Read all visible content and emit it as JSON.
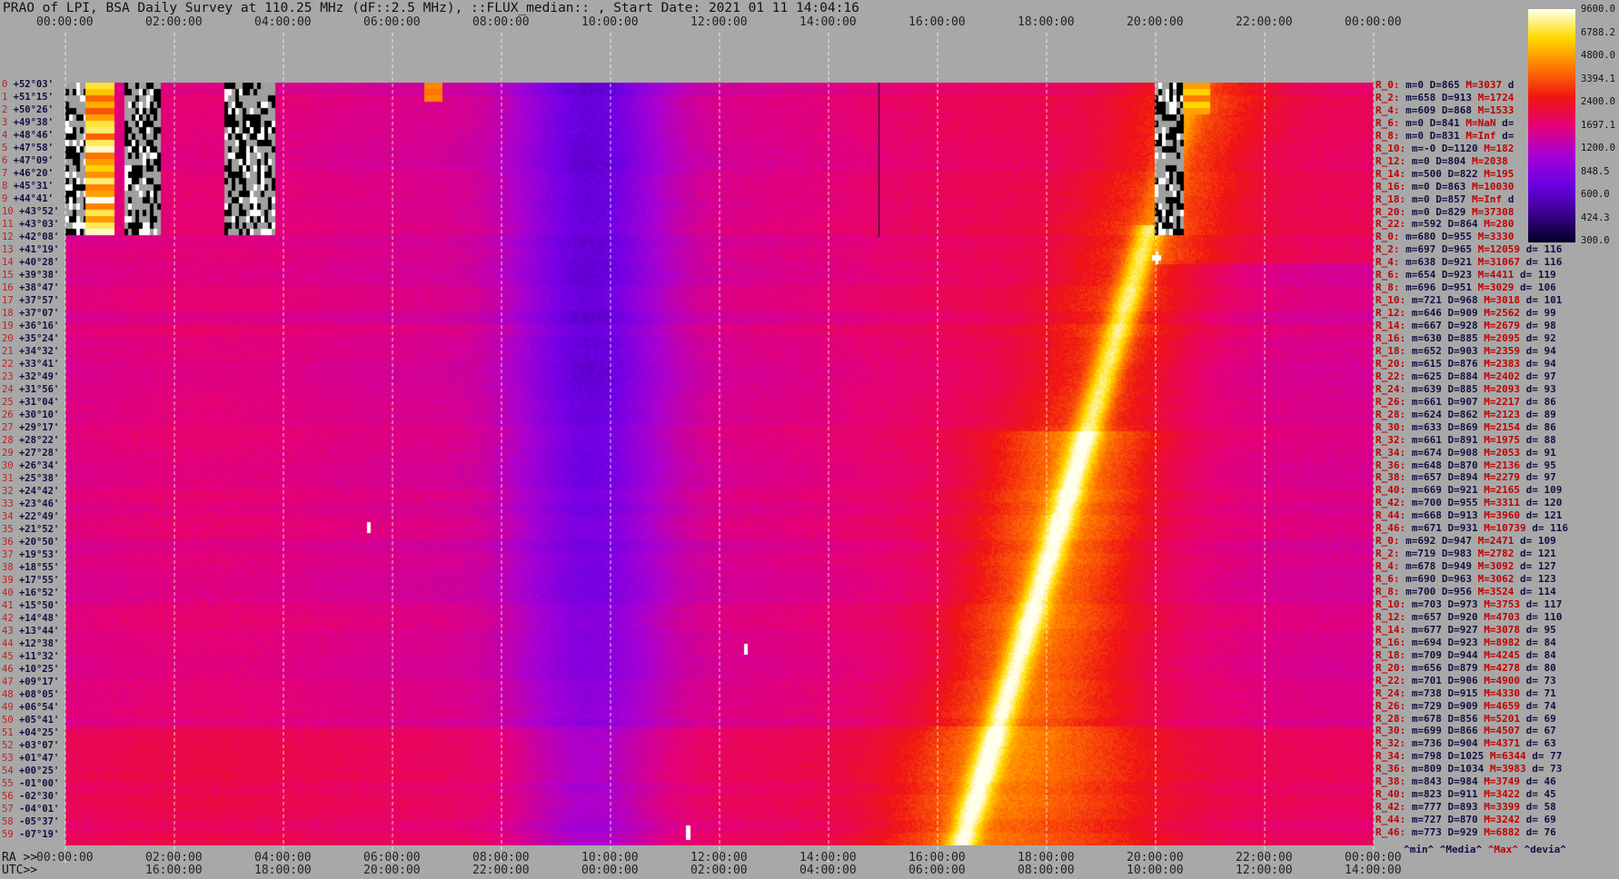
{
  "title": "PRAO of LPI, BSA Daily Survey at 110.25 MHz (dF::2.5 MHz), ::FLUX_median:: , Start Date: 2021 01 11 14:04:16",
  "footer": {
    "ra_prefix": "RA >>",
    "utc_prefix": "UTC>>",
    "legend": [
      "^min^",
      "^Media^",
      "^Max^",
      "^devia^"
    ]
  },
  "colors": {
    "background": "#a8a8a8",
    "label_dark": "#101040",
    "label_red": "#c00000"
  },
  "chart_data": {
    "type": "heatmap",
    "x_top_ticks": [
      "00:00:00",
      "02:00:00",
      "04:00:00",
      "06:00:00",
      "08:00:00",
      "10:00:00",
      "12:00:00",
      "14:00:00",
      "16:00:00",
      "18:00:00",
      "20:00:00",
      "22:00:00",
      "00:00:00"
    ],
    "x_bottom_ra_ticks": [
      "00:00:00",
      "02:00:00",
      "04:00:00",
      "06:00:00",
      "08:00:00",
      "10:00:00",
      "12:00:00",
      "14:00:00",
      "16:00:00",
      "18:00:00",
      "20:00:00",
      "22:00:00",
      "00:00:00"
    ],
    "x_bottom_utc_ticks": [
      "16:00:00",
      "18:00:00",
      "20:00:00",
      "22:00:00",
      "00:00:00",
      "02:00:00",
      "04:00:00",
      "06:00:00",
      "08:00:00",
      "10:00:00",
      "12:00:00",
      "14:00:00"
    ],
    "declinations": [
      "+52°03'",
      "+51°15'",
      "+50°26'",
      "+49°38'",
      "+48°46'",
      "+47°58'",
      "+47°09'",
      "+46°20'",
      "+45°31'",
      "+44°41'",
      "+43°52'",
      "+43°03'",
      "+42°08'",
      "+41°19'",
      "+40°28'",
      "+39°38'",
      "+38°47'",
      "+37°57'",
      "+37°07'",
      "+36°16'",
      "+35°24'",
      "+34°32'",
      "+33°41'",
      "+32°49'",
      "+31°56'",
      "+31°04'",
      "+30°10'",
      "+29°17'",
      "+28°22'",
      "+27°28'",
      "+26°34'",
      "+25°38'",
      "+24°42'",
      "+23°46'",
      "+22°49'",
      "+21°52'",
      "+20°50'",
      "+19°53'",
      "+18°55'",
      "+17°55'",
      "+16°52'",
      "+15°50'",
      "+14°48'",
      "+13°44'",
      "+12°38'",
      "+11°32'",
      "+10°25'",
      "+09°17'",
      "+08°05'",
      "+06°54'",
      "+05°41'",
      "+04°25'",
      "+03°07'",
      "+01°47'",
      "+00°25'",
      "-01°00'",
      "-02°30'",
      "-04°01'",
      "-05°37'",
      "-07°19'"
    ],
    "dec_index": [
      "0",
      "1",
      "2",
      "3",
      "4",
      "5",
      "6",
      "7",
      "8",
      "9",
      "10",
      "11",
      "12",
      "13",
      "14",
      "15",
      "16",
      "17",
      "18",
      "19",
      "20",
      "21",
      "22",
      "23",
      "24",
      "25",
      "26",
      "27",
      "28",
      "29",
      "30",
      "31",
      "32",
      "33",
      "34",
      "35",
      "36",
      "37",
      "38",
      "39",
      "40",
      "41",
      "42",
      "43",
      "44",
      "45",
      "46",
      "47",
      "48",
      "49",
      "50",
      "51",
      "52",
      "53",
      "54",
      "55",
      "56",
      "57",
      "58",
      "59"
    ],
    "colorbar": {
      "ticks": [
        "9600.0",
        "6788.2",
        "4800.0",
        "3394.1",
        "2400.0",
        "1697.1",
        "1200.0",
        "848.5",
        "600.0",
        "424.3",
        "300.0"
      ],
      "colormap": "gnuplot-hot"
    },
    "stats": [
      {
        "r": "R_0:",
        "min": "m=0",
        "med": "D=865",
        "max": "M=3037",
        "dev": "d"
      },
      {
        "r": "R_2:",
        "min": "m=658",
        "med": "D=913",
        "max": "M=1724",
        "dev": ""
      },
      {
        "r": "R_4:",
        "min": "m=609",
        "med": "D=868",
        "max": "M=1533",
        "dev": ""
      },
      {
        "r": "R_6:",
        "min": "m=0",
        "med": "D=841",
        "max": "M=NaN",
        "dev": "d="
      },
      {
        "r": "R_8:",
        "min": "m=0",
        "med": "D=831",
        "max": "M=Inf",
        "dev": "d="
      },
      {
        "r": "R_10:",
        "min": "m=-0",
        "med": "D=1120",
        "max": "M=182",
        "dev": ""
      },
      {
        "r": "R_12:",
        "min": "m=0",
        "med": "D=804",
        "max": "M=2038",
        "dev": ""
      },
      {
        "r": "R_14:",
        "min": "m=500",
        "med": "D=822",
        "max": "M=195",
        "dev": ""
      },
      {
        "r": "R_16:",
        "min": "m=0",
        "med": "D=863",
        "max": "M=10030",
        "dev": ""
      },
      {
        "r": "R_18:",
        "min": "m=0",
        "med": "D=857",
        "max": "M=Inf",
        "dev": "d"
      },
      {
        "r": "R_20:",
        "min": "m=0",
        "med": "D=829",
        "max": "M=37308",
        "dev": ""
      },
      {
        "r": "R_22:",
        "min": "m=592",
        "med": "D=864",
        "max": "M=280",
        "dev": ""
      },
      {
        "r": "R_0:",
        "min": "m=680",
        "med": "D=955",
        "max": "M=3330",
        "dev": ""
      },
      {
        "r": "R_2:",
        "min": "m=697",
        "med": "D=965",
        "max": "M=12059",
        "dev": "d= 116"
      },
      {
        "r": "R_4:",
        "min": "m=638",
        "med": "D=921",
        "max": "M=31067",
        "dev": "d= 116"
      },
      {
        "r": "R_6:",
        "min": "m=654",
        "med": "D=923",
        "max": "M=4411",
        "dev": "d= 119"
      },
      {
        "r": "R_8:",
        "min": "m=696",
        "med": "D=951",
        "max": "M=3029",
        "dev": "d= 106"
      },
      {
        "r": "R_10:",
        "min": "m=721",
        "med": "D=968",
        "max": "M=3018",
        "dev": "d= 101"
      },
      {
        "r": "R_12:",
        "min": "m=646",
        "med": "D=909",
        "max": "M=2562",
        "dev": "d= 99"
      },
      {
        "r": "R_14:",
        "min": "m=667",
        "med": "D=928",
        "max": "M=2679",
        "dev": "d= 98"
      },
      {
        "r": "R_16:",
        "min": "m=630",
        "med": "D=885",
        "max": "M=2095",
        "dev": "d= 92"
      },
      {
        "r": "R_18:",
        "min": "m=652",
        "med": "D=903",
        "max": "M=2359",
        "dev": "d= 94"
      },
      {
        "r": "R_20:",
        "min": "m=615",
        "med": "D=876",
        "max": "M=2383",
        "dev": "d= 94"
      },
      {
        "r": "R_22:",
        "min": "m=625",
        "med": "D=884",
        "max": "M=2402",
        "dev": "d= 97"
      },
      {
        "r": "R_24:",
        "min": "m=639",
        "med": "D=885",
        "max": "M=2093",
        "dev": "d= 93"
      },
      {
        "r": "R_26:",
        "min": "m=661",
        "med": "D=907",
        "max": "M=2217",
        "dev": "d= 86"
      },
      {
        "r": "R_28:",
        "min": "m=624",
        "med": "D=862",
        "max": "M=2123",
        "dev": "d= 89"
      },
      {
        "r": "R_30:",
        "min": "m=633",
        "med": "D=869",
        "max": "M=2154",
        "dev": "d= 86"
      },
      {
        "r": "R_32:",
        "min": "m=661",
        "med": "D=891",
        "max": "M=1975",
        "dev": "d= 88"
      },
      {
        "r": "R_34:",
        "min": "m=674",
        "med": "D=908",
        "max": "M=2053",
        "dev": "d= 91"
      },
      {
        "r": "R_36:",
        "min": "m=648",
        "med": "D=870",
        "max": "M=2136",
        "dev": "d= 95"
      },
      {
        "r": "R_38:",
        "min": "m=657",
        "med": "D=894",
        "max": "M=2279",
        "dev": "d= 97"
      },
      {
        "r": "R_40:",
        "min": "m=669",
        "med": "D=921",
        "max": "M=2165",
        "dev": "d= 109"
      },
      {
        "r": "R_42:",
        "min": "m=700",
        "med": "D=955",
        "max": "M=3311",
        "dev": "d= 120"
      },
      {
        "r": "R_44:",
        "min": "m=668",
        "med": "D=913",
        "max": "M=3960",
        "dev": "d= 121"
      },
      {
        "r": "R_46:",
        "min": "m=671",
        "med": "D=931",
        "max": "M=10739",
        "dev": "d= 116"
      },
      {
        "r": "R_0:",
        "min": "m=692",
        "med": "D=947",
        "max": "M=2471",
        "dev": "d= 109"
      },
      {
        "r": "R_2:",
        "min": "m=719",
        "med": "D=983",
        "max": "M=2782",
        "dev": "d= 121"
      },
      {
        "r": "R_4:",
        "min": "m=678",
        "med": "D=949",
        "max": "M=3092",
        "dev": "d= 127"
      },
      {
        "r": "R_6:",
        "min": "m=690",
        "med": "D=963",
        "max": "M=3062",
        "dev": "d= 123"
      },
      {
        "r": "R_8:",
        "min": "m=700",
        "med": "D=956",
        "max": "M=3524",
        "dev": "d= 114"
      },
      {
        "r": "R_10:",
        "min": "m=703",
        "med": "D=973",
        "max": "M=3753",
        "dev": "d= 117"
      },
      {
        "r": "R_12:",
        "min": "m=657",
        "med": "D=920",
        "max": "M=4703",
        "dev": "d= 110"
      },
      {
        "r": "R_14:",
        "min": "m=677",
        "med": "D=927",
        "max": "M=3078",
        "dev": "d= 95"
      },
      {
        "r": "R_16:",
        "min": "m=694",
        "med": "D=923",
        "max": "M=8982",
        "dev": "d= 84"
      },
      {
        "r": "R_18:",
        "min": "m=709",
        "med": "D=944",
        "max": "M=4245",
        "dev": "d= 84"
      },
      {
        "r": "R_20:",
        "min": "m=656",
        "med": "D=879",
        "max": "M=4278",
        "dev": "d= 80"
      },
      {
        "r": "R_22:",
        "min": "m=701",
        "med": "D=906",
        "max": "M=4900",
        "dev": "d= 73"
      },
      {
        "r": "R_24:",
        "min": "m=738",
        "med": "D=915",
        "max": "M=4330",
        "dev": "d= 71"
      },
      {
        "r": "R_26:",
        "min": "m=729",
        "med": "D=909",
        "max": "M=4659",
        "dev": "d= 74"
      },
      {
        "r": "R_28:",
        "min": "m=678",
        "med": "D=856",
        "max": "M=5201",
        "dev": "d= 69"
      },
      {
        "r": "R_30:",
        "min": "m=699",
        "med": "D=866",
        "max": "M=4507",
        "dev": "d= 67"
      },
      {
        "r": "R_32:",
        "min": "m=736",
        "med": "D=904",
        "max": "M=4371",
        "dev": "d= 63"
      },
      {
        "r": "R_34:",
        "min": "m=798",
        "med": "D=1025",
        "max": "M=6344",
        "dev": "d= 77"
      },
      {
        "r": "R_36:",
        "min": "m=809",
        "med": "D=1034",
        "max": "M=3983",
        "dev": "d= 73"
      },
      {
        "r": "R_38:",
        "min": "m=843",
        "med": "D=984",
        "max": "M=3749",
        "dev": "d= 46"
      },
      {
        "r": "R_40:",
        "min": "m=823",
        "med": "D=911",
        "max": "M=3422",
        "dev": "d= 45"
      },
      {
        "r": "R_42:",
        "min": "m=777",
        "med": "D=893",
        "max": "M=3399",
        "dev": "d= 58"
      },
      {
        "r": "R_44:",
        "min": "m=727",
        "med": "D=870",
        "max": "M=3242",
        "dev": "d= 69"
      },
      {
        "r": "R_46:",
        "min": "m=773",
        "med": "D=929",
        "max": "M=6882",
        "dev": "d= 76"
      }
    ]
  }
}
